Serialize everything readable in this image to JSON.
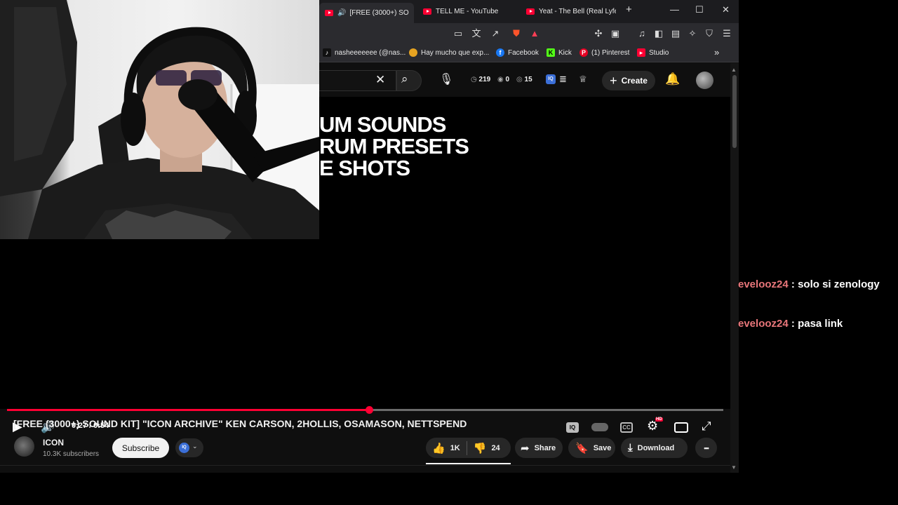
{
  "browser": {
    "tabs": [
      {
        "label": "[FREE (3000+) SO",
        "active": true,
        "audio": true
      },
      {
        "label": "TELL ME - YouTube",
        "active": false
      },
      {
        "label": "Yeat - The Bell (Real Lyfe",
        "active": false
      }
    ],
    "new_tab_glyph": "+",
    "window_controls": {
      "minimize": "—",
      "maximize": "☐",
      "close": "✕"
    },
    "bookmarks": [
      {
        "label": "nasheeeeeee (@nas...",
        "icon": "tiktok-icon",
        "color": "#111111"
      },
      {
        "label": "Hay mucho que exp...",
        "icon": "chrome-icon",
        "color": "#e6a321"
      },
      {
        "label": "Facebook",
        "icon": "facebook-icon",
        "color": "#1877f2"
      },
      {
        "label": "Kick",
        "icon": "kick-icon",
        "color": "#53fc18"
      },
      {
        "label": "(1) Pinterest",
        "icon": "pinterest-icon",
        "color": "#e60023"
      },
      {
        "label": "Studio",
        "icon": "youtube-studio-icon",
        "color": "#ff0033"
      }
    ],
    "more_bookmarks_glyph": "»"
  },
  "masthead": {
    "stats": {
      "views": "219",
      "likes": "0",
      "watching": "15"
    },
    "create_label": "Create",
    "create_glyph": "+"
  },
  "player": {
    "overlay_lines": [
      "UM SOUNDS",
      "RUM PRESETS",
      "E SHOTS"
    ],
    "time_display": "0:27 / 0:54",
    "progress_fraction": 0.505,
    "hd_badge": "HD",
    "accent_color": "#ff0033"
  },
  "video": {
    "title": "[FREE (3000+) SOUND KIT] \"ICON ARCHIVE\" KEN CARSON, 2HOLLIS, OSAMASON, NETTSPEND",
    "channel_name": "ICON",
    "subscribers": "10.3K subscribers",
    "subscribe_label": "Subscribe",
    "likes": "1K",
    "dislikes": "24",
    "share_label": "Share",
    "save_label": "Save",
    "download_label": "Download",
    "more_glyph": "•••"
  },
  "chat": [
    {
      "user": "evelooz24",
      "separator": " : ",
      "message": "solo si zenology",
      "user_color": "#e8767a"
    },
    {
      "user": "evelooz24",
      "separator": " : ",
      "message": "pasa link",
      "user_color": "#e8767a"
    }
  ]
}
